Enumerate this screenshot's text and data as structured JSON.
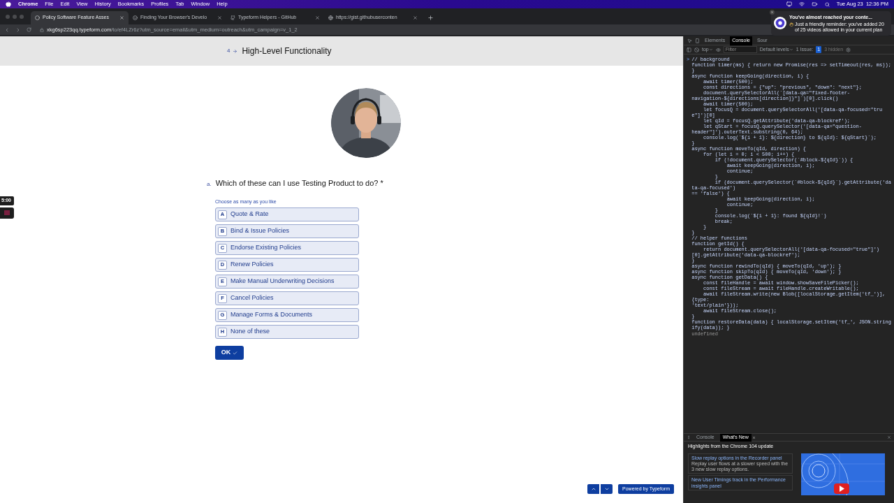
{
  "menu_bar": {
    "app": "Chrome",
    "items": [
      "File",
      "Edit",
      "View",
      "History",
      "Bookmarks",
      "Profiles",
      "Tab",
      "Window",
      "Help"
    ],
    "clock": "Tue Aug 23  12:36 PM"
  },
  "browser": {
    "tabs": [
      {
        "title": "Policy Software Feature Asses",
        "selected": true
      },
      {
        "title": "Finding Your Browser's Develo",
        "selected": false
      },
      {
        "title": "Typeform Helpers - GitHub",
        "selected": false
      },
      {
        "title": "https://gist.githubuserconten",
        "selected": false
      }
    ],
    "url_host": "xkg6sp223qq.typeform.com",
    "url_path": "/to/ef4LZr6z?utm_source=email&utm_medium=outreach&utm_campaign=v_1_2"
  },
  "form": {
    "section_number": "4",
    "section_title": "High-Level Functionality",
    "question_label": "a.",
    "question": "Which of these can I use Testing Product to do?",
    "required_mark": "*",
    "hint": "Choose as many as you like",
    "options": [
      {
        "key": "A",
        "label": "Quote & Rate",
        "selected": false
      },
      {
        "key": "B",
        "label": "Bind & Issue Policies",
        "selected": false
      },
      {
        "key": "C",
        "label": "Endorse Existing Policies",
        "selected": false
      },
      {
        "key": "D",
        "label": "Renew Policies",
        "selected": false
      },
      {
        "key": "E",
        "label": "Make Manual Underwriting Decisions",
        "selected": false
      },
      {
        "key": "F",
        "label": "Cancel Policies",
        "selected": false
      },
      {
        "key": "G",
        "label": "Manage Forms & Documents",
        "selected": false
      },
      {
        "key": "H",
        "label": "None of these",
        "selected": false
      }
    ],
    "ok_button": "OK",
    "powered_by": "Powered by Typeform"
  },
  "recorder": {
    "timer": "5:00"
  },
  "devtools": {
    "tabs": [
      {
        "label": "Elements",
        "selected": false
      },
      {
        "label": "Console",
        "selected": true
      },
      {
        "label": "Sour",
        "selected": false
      }
    ],
    "context": "top",
    "filter_placeholder": "Filter",
    "levels": "Default levels",
    "issues_label": "1 Issue:",
    "issues_count": "1",
    "hidden": "3 hidden",
    "prompt": ">",
    "code": [
      "// background",
      "function timer(ms) { return new Promise(res => setTimeout(res, ms)); }",
      "async function keepGoing(direction, i) {",
      "    await timer(500);",
      "    const directions = {\"up\": \"previous\", \"down\": \"next\"};",
      "    document.querySelectorAll(`[data-qa=\"fixed-footer-",
      "navigation-${directions[direction]}\"]`)[0].click()",
      "    await timer(500);",
      "    let focusQ = document.querySelectorAll('[data-qa-focused=\"true\"]')[0]",
      "    let qId = focusQ.getAttribute('data-qa-blockref');",
      "    let qStart = focusQ.querySelector('[data-qa=\"question-",
      "header\"]').outerText.substring(0, 64);",
      "    console.log(`${i + 1}: ${direction} to ${qId}: ${qStart}`);",
      "}",
      "async function moveTo(qId, direction) {",
      "    for (let i = 0; i < 500; i++) {",
      "        if (!document.querySelector(`#block-${qId}`)) {",
      "            await keepGoing(direction, i);",
      "            continue;",
      "        }",
      "        if (document.querySelector(`#block-${qId}`).getAttribute('data-qa-focused')",
      "== 'false') {",
      "            await keepGoing(direction, i);",
      "            continue;",
      "        }",
      "        console.log(`${i + 1}: found ${qId}!`)",
      "        break;",
      "    }",
      "}",
      "// helper functions",
      "function getId() {",
      "    return document.querySelectorAll('[data-qa-focused=\"true\"]')",
      "[0].getAttribute('data-qa-blockref');",
      "}",
      "async function rewindTo(qId) { moveTo(qId, 'up'); }",
      "async function skipTo(qId) { moveTo(qId, 'down'); }",
      "async function getData() {",
      "    const fileHandle = await window.showSaveFilePicker();",
      "    const fileStream = await fileHandle.createWritable();",
      "    await fileStream.write(new Blob([localStorage.getItem('tf_')], {type:",
      "'text/plain'}));",
      "    await fileStream.close();",
      "}",
      "function restoreData(data) { localStorage.setItem('tf_', JSON.stringify(data)); }"
    ],
    "result": "undefined"
  },
  "notification": {
    "title": "You've almost reached your conte...",
    "body": "Just a friendly reminder: you've added 20 of 25 videos allowed in your current plan"
  },
  "drawer": {
    "tabs": [
      {
        "label": "Console",
        "selected": false
      },
      {
        "label": "What's New",
        "selected": true
      }
    ],
    "heading": "Highlights from the Chrome 104 update",
    "items": [
      {
        "title": "Slow replay options in the Recorder panel",
        "description": "Replay user flows at a slower speed with the 3 new slow replay options."
      },
      {
        "title": "New User Timings track in the Performance insights panel"
      }
    ]
  }
}
